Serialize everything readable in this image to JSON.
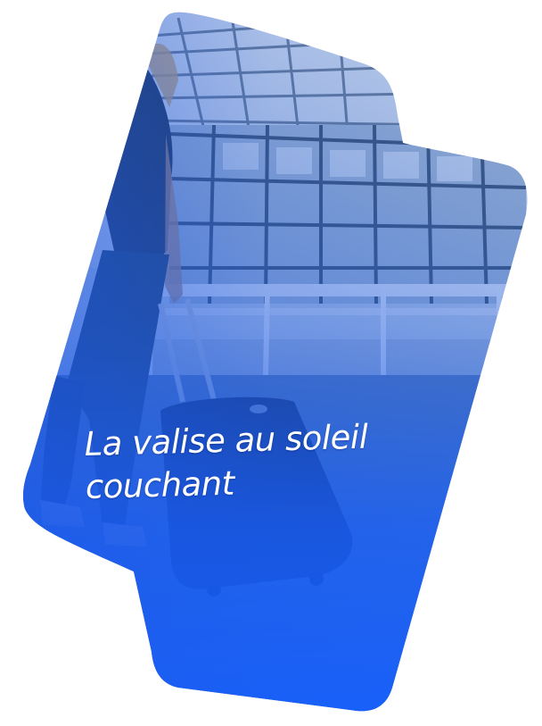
{
  "card": {
    "caption": "La valise au soleil couchant",
    "colors": {
      "overlay_top": "#6d8fb8",
      "overlay_bottom": "#1a5ff5",
      "sky": "#d9e2ec"
    }
  }
}
